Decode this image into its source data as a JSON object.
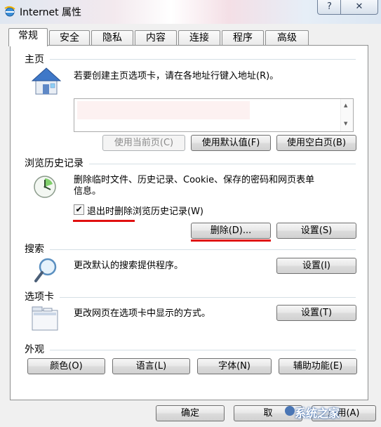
{
  "window": {
    "title": "Internet 属性",
    "help_label": "?",
    "close_label": "✕"
  },
  "tabs": [
    {
      "label": "常规",
      "active": true
    },
    {
      "label": "安全"
    },
    {
      "label": "隐私"
    },
    {
      "label": "内容"
    },
    {
      "label": "连接"
    },
    {
      "label": "程序"
    },
    {
      "label": "高级"
    }
  ],
  "homepage": {
    "title": "主页",
    "desc": "若要创建主页选项卡，请在各地址行键入地址(R)。",
    "url_value": "",
    "use_current": "使用当前页(C)",
    "use_default": "使用默认值(F)",
    "use_blank": "使用空白页(B)"
  },
  "history": {
    "title": "浏览历史记录",
    "desc_line1": "删除临时文件、历史记录、Cookie、保存的密码和网页表单",
    "desc_line2": "信息。",
    "checkbox_label": "退出时删除浏览历史记录(W)",
    "checkbox_checked": true,
    "delete_button": "删除(D)...",
    "settings_button": "设置(S)"
  },
  "search": {
    "title": "搜索",
    "desc": "更改默认的搜索提供程序。",
    "settings_button": "设置(I)"
  },
  "tabs_section": {
    "title": "选项卡",
    "desc": "更改网页在选项卡中显示的方式。",
    "settings_button": "设置(T)"
  },
  "appearance": {
    "title": "外观",
    "colors": "颜色(O)",
    "languages": "语言(L)",
    "fonts": "字体(N)",
    "accessibility": "辅助功能(E)"
  },
  "footer": {
    "ok": "确定",
    "cancel": "取",
    "apply": "应用(A)"
  },
  "watermark": "系统之家",
  "colors": {
    "annotation_red": "#e01010"
  }
}
